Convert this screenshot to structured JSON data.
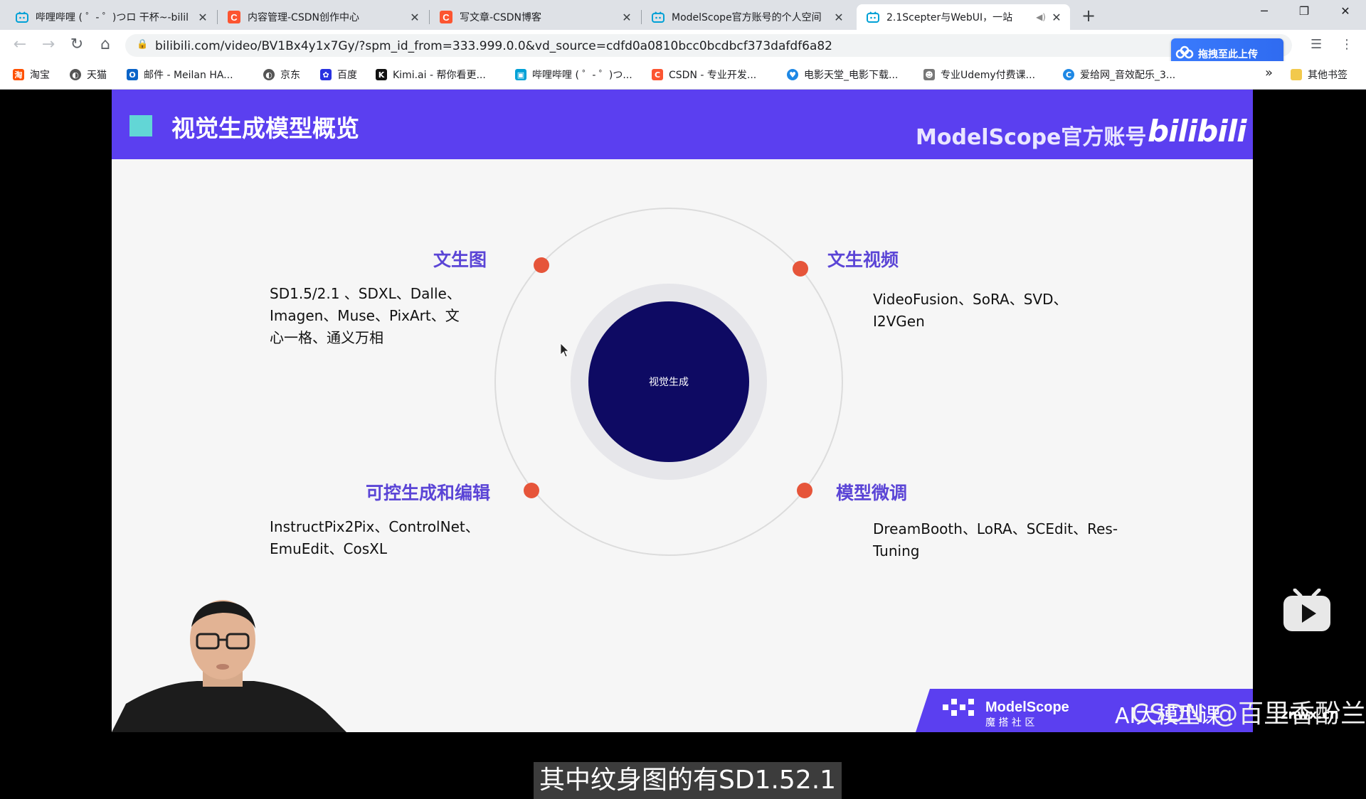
{
  "tabs": [
    {
      "title": "哔哩哔哩 ( ゜- ゜)つロ 干杯~-bilil",
      "icon": "bilibili-icon",
      "active": false
    },
    {
      "title": "内容管理-CSDN创作中心",
      "icon": "csdn-icon",
      "active": false
    },
    {
      "title": "写文章-CSDN博客",
      "icon": "csdn-icon",
      "active": false
    },
    {
      "title": "ModelScope官方账号的个人空间",
      "icon": "bilibili-icon",
      "active": false
    },
    {
      "title": "2.1Scepter与WebUI，一站",
      "icon": "bilibili-icon",
      "active": true
    }
  ],
  "toolbar": {
    "url": "bilibili.com/video/BV1Bx4y1x7Gy/?spm_id_from=333.999.0.0&vd_source=cdfd0a0810bcc0bcdbcf373dafdf6a82",
    "upload_label": "拖拽至此上传"
  },
  "bookmarks": [
    {
      "label": "淘宝",
      "color": "#ff5000"
    },
    {
      "label": "天猫",
      "color": "#555555"
    },
    {
      "label": "邮件 - Meilan HA...",
      "color": "#0a64c8"
    },
    {
      "label": "京东",
      "color": "#555555"
    },
    {
      "label": "百度",
      "color": "#2932e1"
    },
    {
      "label": "Kimi.ai - 帮你看更...",
      "color": "#111111"
    },
    {
      "label": "哔哩哔哩 ( ゜- ゜)つ...",
      "color": "#00a1d6"
    },
    {
      "label": "CSDN - 专业开发...",
      "color": "#fc5531"
    },
    {
      "label": "电影天堂_电影下载...",
      "color": "#1e88e5"
    },
    {
      "label": "专业Udemy付费课...",
      "color": "#777777"
    },
    {
      "label": "爱给网_音效配乐_3...",
      "color": "#1e88e5"
    },
    {
      "label": "其他书签",
      "color": "#f2c94c"
    }
  ],
  "slide": {
    "title": "视觉生成模型概览",
    "brand": "ModelScope官方账号",
    "brand_logo": "bilibili",
    "center_label": "视觉生成",
    "categories": [
      {
        "label": "文生图",
        "desc_lines": [
          "SD1.5/2.1 、SDXL、Dalle、",
          "Imagen、Muse、PixArt、文",
          "心一格、通义万相"
        ]
      },
      {
        "label": "文生视频",
        "desc_lines": [
          "VideoFusion、SoRA、SVD、",
          "I2VGen"
        ]
      },
      {
        "label": "可控生成和编辑",
        "desc_lines": [
          "InstructPix2Pix、ControlNet、",
          "EmuEdit、CosXL"
        ]
      },
      {
        "label": "模型微调",
        "desc_lines": [
          "DreamBooth、LoRA、SCEdit、Res-",
          "Tuning"
        ]
      }
    ],
    "footer_brand": "ModelScope",
    "footer_brand_cn": "魔 搭 社 区",
    "footer_text": "AI大模型课"
  },
  "subtitle": "其中纹身图的有SD1.52.1",
  "watermark": "CSDN @百里香酚兰",
  "watermark_small": "znwx.cn",
  "colors": {
    "slide_header": "#5b3ff0",
    "accent_dot": "#e6553a",
    "center_circle": "#0e0a63",
    "label_purple": "#5b45d6"
  }
}
